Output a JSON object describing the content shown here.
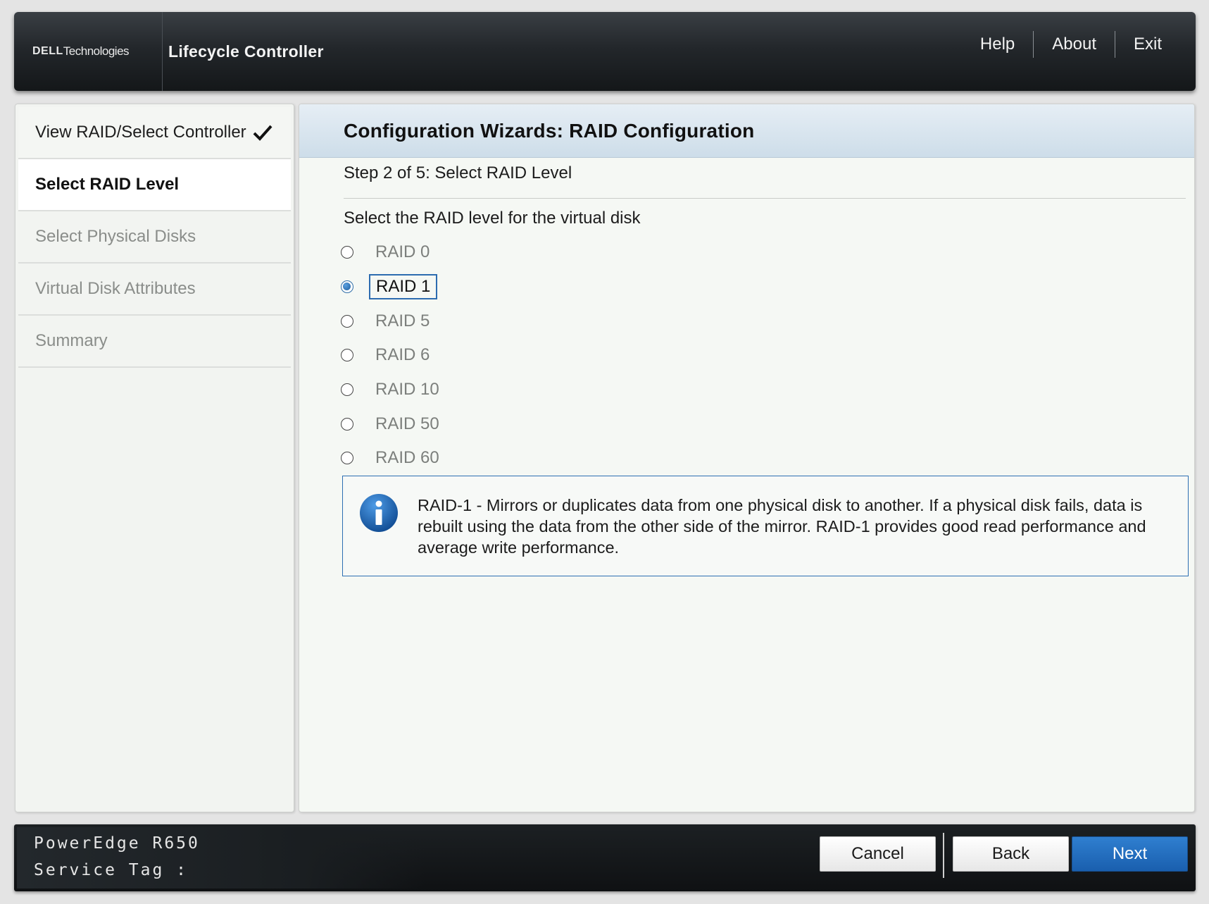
{
  "header": {
    "brand_dell": "DELL",
    "brand_tech": "Technologies",
    "app_title": "Lifecycle Controller",
    "nav": {
      "help": "Help",
      "about": "About",
      "exit": "Exit"
    }
  },
  "sidebar": {
    "items": [
      {
        "label": "View RAID/Select Controller",
        "state": "completed"
      },
      {
        "label": "Select RAID Level",
        "state": "active"
      },
      {
        "label": "Select Physical Disks",
        "state": "pending"
      },
      {
        "label": "Virtual Disk Attributes",
        "state": "pending"
      },
      {
        "label": "Summary",
        "state": "pending"
      }
    ]
  },
  "main": {
    "title": "Configuration Wizards: RAID Configuration",
    "step": "Step 2 of 5: Select RAID Level",
    "prompt": "Select the RAID level for the virtual disk",
    "raid_options": [
      {
        "label": "RAID 0",
        "checked": false
      },
      {
        "label": "RAID 1",
        "checked": true
      },
      {
        "label": "RAID 5",
        "checked": false
      },
      {
        "label": "RAID 6",
        "checked": false
      },
      {
        "label": "RAID 10",
        "checked": false
      },
      {
        "label": "RAID 50",
        "checked": false
      },
      {
        "label": "RAID 60",
        "checked": false
      }
    ],
    "info": {
      "icon": "info-icon",
      "text": "RAID-1 - Mirrors or duplicates data from one physical disk to another. If a physical disk fails, data is rebuilt using the data from the other side of the mirror. RAID-1 provides good read performance and average write performance."
    }
  },
  "footer": {
    "model": "PowerEdge R650",
    "service_tag": "Service Tag :",
    "buttons": {
      "cancel": "Cancel",
      "back": "Back",
      "next": "Next"
    }
  },
  "colors": {
    "accent": "#1a5fae",
    "selection_border": "#2c6cb0",
    "header_bg": "#23272b"
  }
}
